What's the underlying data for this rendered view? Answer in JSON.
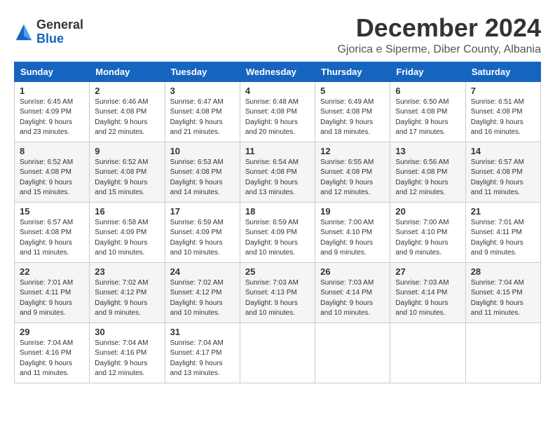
{
  "header": {
    "logo_line1": "General",
    "logo_line2": "Blue",
    "month_title": "December 2024",
    "location": "Gjorica e Siperme, Diber County, Albania"
  },
  "weekdays": [
    "Sunday",
    "Monday",
    "Tuesday",
    "Wednesday",
    "Thursday",
    "Friday",
    "Saturday"
  ],
  "weeks": [
    [
      {
        "day": "1",
        "sunrise": "6:45 AM",
        "sunset": "4:09 PM",
        "daylight": "9 hours and 23 minutes."
      },
      {
        "day": "2",
        "sunrise": "6:46 AM",
        "sunset": "4:08 PM",
        "daylight": "9 hours and 22 minutes."
      },
      {
        "day": "3",
        "sunrise": "6:47 AM",
        "sunset": "4:08 PM",
        "daylight": "9 hours and 21 minutes."
      },
      {
        "day": "4",
        "sunrise": "6:48 AM",
        "sunset": "4:08 PM",
        "daylight": "9 hours and 20 minutes."
      },
      {
        "day": "5",
        "sunrise": "6:49 AM",
        "sunset": "4:08 PM",
        "daylight": "9 hours and 18 minutes."
      },
      {
        "day": "6",
        "sunrise": "6:50 AM",
        "sunset": "4:08 PM",
        "daylight": "9 hours and 17 minutes."
      },
      {
        "day": "7",
        "sunrise": "6:51 AM",
        "sunset": "4:08 PM",
        "daylight": "9 hours and 16 minutes."
      }
    ],
    [
      {
        "day": "8",
        "sunrise": "6:52 AM",
        "sunset": "4:08 PM",
        "daylight": "9 hours and 15 minutes."
      },
      {
        "day": "9",
        "sunrise": "6:52 AM",
        "sunset": "4:08 PM",
        "daylight": "9 hours and 15 minutes."
      },
      {
        "day": "10",
        "sunrise": "6:53 AM",
        "sunset": "4:08 PM",
        "daylight": "9 hours and 14 minutes."
      },
      {
        "day": "11",
        "sunrise": "6:54 AM",
        "sunset": "4:08 PM",
        "daylight": "9 hours and 13 minutes."
      },
      {
        "day": "12",
        "sunrise": "6:55 AM",
        "sunset": "4:08 PM",
        "daylight": "9 hours and 12 minutes."
      },
      {
        "day": "13",
        "sunrise": "6:56 AM",
        "sunset": "4:08 PM",
        "daylight": "9 hours and 12 minutes."
      },
      {
        "day": "14",
        "sunrise": "6:57 AM",
        "sunset": "4:08 PM",
        "daylight": "9 hours and 11 minutes."
      }
    ],
    [
      {
        "day": "15",
        "sunrise": "6:57 AM",
        "sunset": "4:08 PM",
        "daylight": "9 hours and 11 minutes."
      },
      {
        "day": "16",
        "sunrise": "6:58 AM",
        "sunset": "4:09 PM",
        "daylight": "9 hours and 10 minutes."
      },
      {
        "day": "17",
        "sunrise": "6:59 AM",
        "sunset": "4:09 PM",
        "daylight": "9 hours and 10 minutes."
      },
      {
        "day": "18",
        "sunrise": "6:59 AM",
        "sunset": "4:09 PM",
        "daylight": "9 hours and 10 minutes."
      },
      {
        "day": "19",
        "sunrise": "7:00 AM",
        "sunset": "4:10 PM",
        "daylight": "9 hours and 9 minutes."
      },
      {
        "day": "20",
        "sunrise": "7:00 AM",
        "sunset": "4:10 PM",
        "daylight": "9 hours and 9 minutes."
      },
      {
        "day": "21",
        "sunrise": "7:01 AM",
        "sunset": "4:11 PM",
        "daylight": "9 hours and 9 minutes."
      }
    ],
    [
      {
        "day": "22",
        "sunrise": "7:01 AM",
        "sunset": "4:11 PM",
        "daylight": "9 hours and 9 minutes."
      },
      {
        "day": "23",
        "sunrise": "7:02 AM",
        "sunset": "4:12 PM",
        "daylight": "9 hours and 9 minutes."
      },
      {
        "day": "24",
        "sunrise": "7:02 AM",
        "sunset": "4:12 PM",
        "daylight": "9 hours and 10 minutes."
      },
      {
        "day": "25",
        "sunrise": "7:03 AM",
        "sunset": "4:13 PM",
        "daylight": "9 hours and 10 minutes."
      },
      {
        "day": "26",
        "sunrise": "7:03 AM",
        "sunset": "4:14 PM",
        "daylight": "9 hours and 10 minutes."
      },
      {
        "day": "27",
        "sunrise": "7:03 AM",
        "sunset": "4:14 PM",
        "daylight": "9 hours and 10 minutes."
      },
      {
        "day": "28",
        "sunrise": "7:04 AM",
        "sunset": "4:15 PM",
        "daylight": "9 hours and 11 minutes."
      }
    ],
    [
      {
        "day": "29",
        "sunrise": "7:04 AM",
        "sunset": "4:16 PM",
        "daylight": "9 hours and 11 minutes."
      },
      {
        "day": "30",
        "sunrise": "7:04 AM",
        "sunset": "4:16 PM",
        "daylight": "9 hours and 12 minutes."
      },
      {
        "day": "31",
        "sunrise": "7:04 AM",
        "sunset": "4:17 PM",
        "daylight": "9 hours and 13 minutes."
      },
      null,
      null,
      null,
      null
    ]
  ],
  "labels": {
    "sunrise": "Sunrise:",
    "sunset": "Sunset:",
    "daylight": "Daylight:"
  }
}
